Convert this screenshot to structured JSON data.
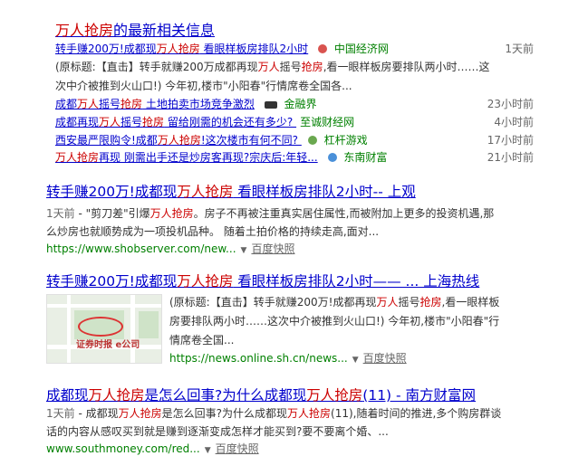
{
  "news_block": {
    "title_hl": "万人抢房",
    "title_rest": "的最新相关信息",
    "items": [
      {
        "pre": "转手赚200万!成都现",
        "hl": "万人抢房",
        "post": " 看眼样板房排队2小时",
        "source": "中国经济网",
        "time": "1天前"
      },
      {
        "pre": "成都",
        "hl": "万人",
        "mid": "摇号",
        "hl2": "抢房",
        "post": " 土地拍卖市场竞争激烈",
        "source": "金融界",
        "time": "23小时前"
      },
      {
        "pre": "成都再现",
        "hl": "万人",
        "mid": "摇号",
        "hl2": "抢房",
        "post": " 留给刚需的机会还有多少? ",
        "source": "至诚财经网",
        "time": "4小时前"
      },
      {
        "pre": "西安最严限购令!成都",
        "hl": "万人抢房",
        "post": "!这次楼市有何不同? ",
        "source": "杠杆游戏",
        "time": "17小时前"
      },
      {
        "pre": "",
        "hl": "万人抢房",
        "post": "再现 刚需出手还是炒房客再现?宗庆后:年轻...",
        "source": "东南财富",
        "time": "21小时前"
      }
    ],
    "abstract": {
      "l1_pre": "(原标题:【直击】转手就赚200万成都再现",
      "l1_hl": "万人",
      "l1_mid": "摇号",
      "l1_hl2": "抢房",
      "l1_post": ",看一眼样板房要排队两小时……这",
      "l2": "次中介被推到火山口!) 今年初,楼市\"小阳春\"行情席卷全国各..."
    }
  },
  "results": [
    {
      "title_pre": "转手赚200万!成都现",
      "title_hl": "万人抢房",
      "title_post": " 看眼样板房排队2小时-- 上观",
      "date": "1天前",
      "line1_pre": " - \"剪刀差\"引爆",
      "line1_hl": "万人抢房",
      "line1_post": "。房子不再被注重真实居住属性,而被附加上更多的投资机遇,那",
      "line2": "么炒房也就顺势成为一项投机品种。 随着土拍价格的持续走高,面对...",
      "url": "https://www.shobserver.com/new...",
      "snapshot": "百度快照"
    },
    {
      "title_pre": "转手赚200万!成都现",
      "title_hl": "万人抢房",
      "title_post": " 看眼样板房排队2小时—— ... 上海热线",
      "thumb_watermark": "证券时报 e公司",
      "line1_pre": "(原标题:【直击】转手就赚200万!成都再现",
      "line1_hl": "万人",
      "line1_mid": "摇号",
      "line1_hl2": "抢房",
      "line1_post": ",看一眼样板",
      "line2": "房要排队两小时……这次中介被推到火山口!) 今年初,楼市\"小阳春\"行",
      "line3": "情席卷全国...",
      "url": "https://news.online.sh.cn/news...",
      "snapshot": "百度快照"
    },
    {
      "title_pre": "成都现",
      "title_hl": "万人抢房",
      "title_mid": "是怎么回事?为什么成都现",
      "title_hl2": "万人抢房",
      "title_post": "(11) - 南方财富网",
      "date": "1天前",
      "line1_pre": " - 成都现",
      "line1_hl": "万人抢房",
      "line1_mid": "是怎么回事?为什么成都现",
      "line1_hl2": "万人抢房",
      "line1_post": "(11),随着时间的推进,多个购房群谈",
      "line2": "话的内容从感叹买到就是赚到逐渐变成怎样才能买到?要不要离个婚、...",
      "url": "www.southmoney.com/red...",
      "snapshot": "百度快照"
    }
  ],
  "colors": {
    "link": "#0000cc",
    "highlight": "#cc0000",
    "url": "#008000"
  }
}
